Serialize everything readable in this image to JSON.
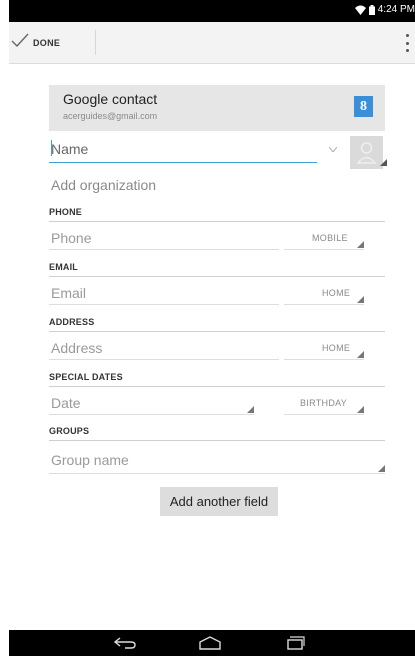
{
  "status_bar": {
    "time": "4:24 PM"
  },
  "action_bar": {
    "done_label": "DONE"
  },
  "account": {
    "title": "Google contact",
    "email": "acerguides@gmail.com",
    "badge": "8"
  },
  "name": {
    "placeholder": "Name"
  },
  "organization": {
    "label": "Add organization"
  },
  "sections": {
    "phone": {
      "header": "PHONE",
      "placeholder": "Phone",
      "type": "MOBILE"
    },
    "email": {
      "header": "EMAIL",
      "placeholder": "Email",
      "type": "HOME"
    },
    "address": {
      "header": "ADDRESS",
      "placeholder": "Address",
      "type": "HOME"
    },
    "special_dates": {
      "header": "SPECIAL DATES",
      "placeholder": "Date",
      "type": "BIRTHDAY"
    },
    "groups": {
      "header": "GROUPS",
      "placeholder": "Group name"
    }
  },
  "add_field_button": {
    "label": "Add another field"
  },
  "icons": [
    "wifi-icon",
    "battery-icon",
    "check-icon",
    "overflow-menu-icon",
    "google-plus-icon",
    "contact-photo-icon",
    "back-icon",
    "home-icon",
    "recent-apps-icon"
  ],
  "colors": {
    "accent": "#3ba3ce",
    "google_badge": "#3b8fd8"
  }
}
